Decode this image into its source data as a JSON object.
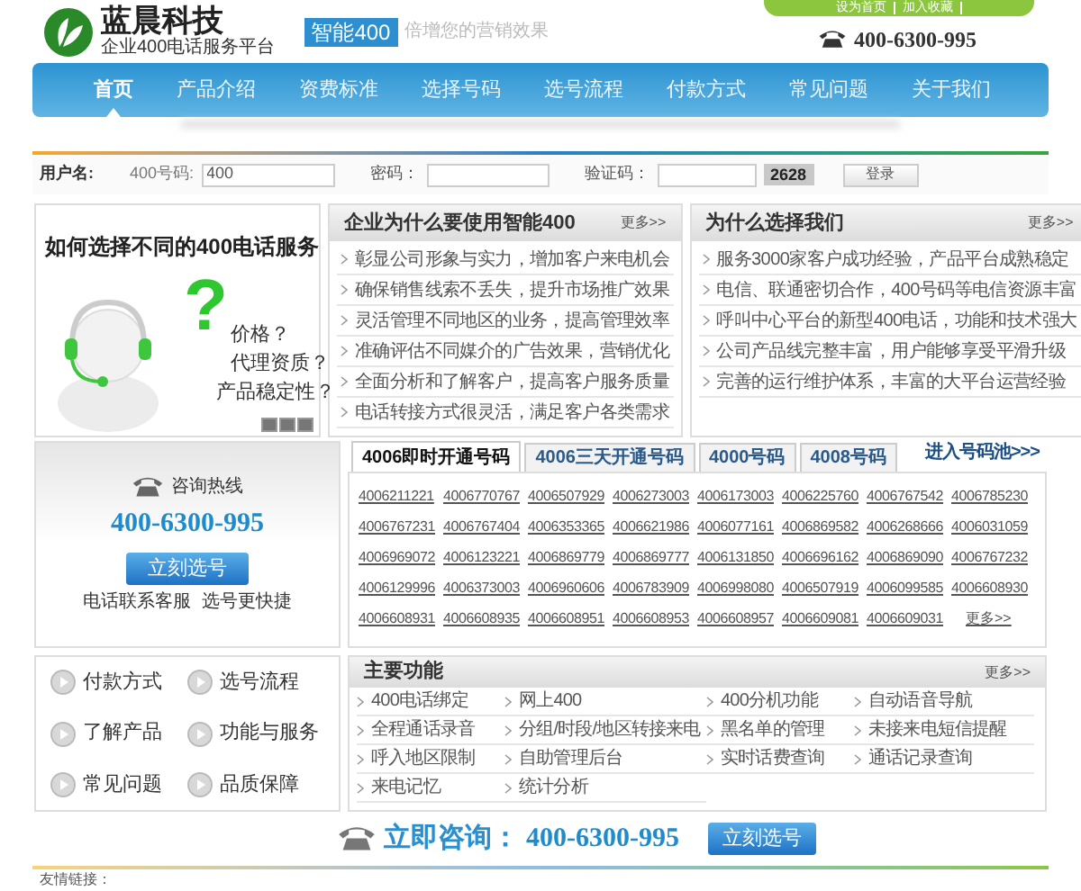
{
  "header": {
    "brand": "蓝晨科技",
    "tagline": "企业400电话服务平台",
    "badge": "智能400",
    "slogan": "倍增您的营销效果",
    "top_links": [
      "设为首页",
      "加入收藏"
    ],
    "phone": "400-6300-995"
  },
  "nav": [
    {
      "label": "首页",
      "selected": true
    },
    {
      "label": "产品介绍",
      "selected": false
    },
    {
      "label": "资费标准",
      "selected": false
    },
    {
      "label": "选择号码",
      "selected": false
    },
    {
      "label": "选号流程",
      "selected": false
    },
    {
      "label": "付款方式",
      "selected": false
    },
    {
      "label": "常见问题",
      "selected": false
    },
    {
      "label": "关于我们",
      "selected": false
    }
  ],
  "login": {
    "user_label": "用户名:",
    "number_label": "400号码:",
    "number_value": "400",
    "password_label": "密码：",
    "captcha_label": "验证码：",
    "captcha": "2628",
    "button": "登录"
  },
  "banner": {
    "title": "如何选择不同的400电话服务",
    "question_mark": "?",
    "questions": [
      "价格？",
      "代理资质？",
      "产品稳定性？"
    ]
  },
  "why_use": {
    "title": "企业为什么要使用智能400",
    "more": "更多>>",
    "items": [
      "彰显公司形象与实力，增加客户来电机会",
      "确保销售线索不丢失，提升市场推广效果",
      "灵活管理不同地区的业务，提高管理效率",
      "准确评估不同媒介的广告效果，营销优化",
      "全面分析和了解客户，提高客户服务质量",
      "电话转接方式很灵活，满足客户各类需求"
    ]
  },
  "why_us": {
    "title": "为什么选择我们",
    "more": "更多>>",
    "items": [
      "服务3000家客户成功经验，产品平台成熟稳定",
      "电信、联通密切合作，400号码等电信资源丰富",
      "呼叫中心平台的新型400电话，功能和技术强大",
      "公司产品线完整丰富，用户能够享受平滑升级",
      "完善的运行维护体系，丰富的大平台运营经验"
    ]
  },
  "hotline": {
    "label": "咨询热线",
    "phone": "400-6300-995",
    "button": "立刻选号",
    "note": "电话联系客服  选号更快捷"
  },
  "number_tabs": [
    {
      "label": "4006即时开通号码",
      "selected": true
    },
    {
      "label": "4006三天开通号码",
      "selected": false
    },
    {
      "label": "4000号码",
      "selected": false
    },
    {
      "label": "4008号码",
      "selected": false
    }
  ],
  "number_pool_link": "进入号码池>>>",
  "numbers": [
    "4006211221",
    "4006770767",
    "4006507929",
    "4006273003",
    "4006173003",
    "4006225760",
    "4006767542",
    "4006785230",
    "4006767231",
    "4006767404",
    "4006353365",
    "4006621986",
    "4006077161",
    "4006869582",
    "4006268666",
    "4006031059",
    "4006969072",
    "4006123221",
    "4006869779",
    "4006869777",
    "4006131850",
    "4006696162",
    "4006869090",
    "4006767232",
    "4006129996",
    "4006373003",
    "4006960606",
    "4006783909",
    "4006998080",
    "4006507919",
    "4006099585",
    "4006608930",
    "4006608931",
    "4006608935",
    "4006608951",
    "4006608953",
    "4006608957",
    "4006609081",
    "4006609031"
  ],
  "numbers_more": "更多>>",
  "quick_links": [
    "付款方式",
    "选号流程",
    "了解产品",
    "功能与服务",
    "常见问题",
    "品质保障"
  ],
  "features": {
    "title": "主要功能",
    "more": "更多>>",
    "items": [
      "400电话绑定",
      "网上400",
      "400分机功能",
      "自动语音导航",
      "全程通话录音",
      "分组/时段/地区转接来电",
      "黑名单的管理",
      "未接来电短信提醒",
      "呼入地区限制",
      "自助管理后台",
      "实时话费查询",
      "通话记录查询",
      "来电记忆",
      "统计分析"
    ]
  },
  "consult": {
    "label": "立即咨询：",
    "phone": "400-6300-995",
    "button": "立刻选号"
  },
  "footer": {
    "friend_links_label": "友情链接："
  }
}
